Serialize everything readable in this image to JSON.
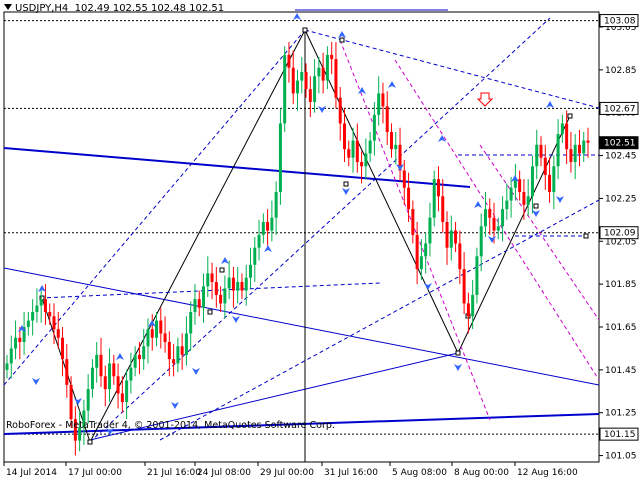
{
  "header": {
    "symbol": "USDJPY,H4",
    "ohlc": "102.49 102.55 102.48 102.51"
  },
  "footer": {
    "copyright": "RoboForex - MetaTrader 4, © 2001-2014, MetaQuotes Software Corp."
  },
  "colors": {
    "bull": "#00b050",
    "bear": "#ff0000",
    "trendline": "#0000cc",
    "fork": "#cc00cc",
    "current_price_bg": "#000000"
  },
  "chart_data": {
    "type": "candlestick",
    "title": "",
    "ylim": [
      101.02,
      103.12
    ],
    "x_tick_labels": [
      "14 Jul 2014",
      "17 Jul 00:00",
      "21 Jul 16:00",
      "24 Jul 08:00",
      "29 Jul 00:00",
      "31 Jul 16:00",
      "5 Aug 08:00",
      "8 Aug 00:00",
      "12 Aug 16:00"
    ],
    "y_tick_labels": [
      "103.05",
      "102.85",
      "102.65",
      "102.45",
      "102.25",
      "102.05",
      "101.85",
      "101.65",
      "101.45",
      "101.25",
      "101.05"
    ],
    "y_tick_values": [
      103.05,
      102.85,
      102.65,
      102.45,
      102.25,
      102.05,
      101.85,
      101.65,
      101.45,
      101.25,
      101.05
    ],
    "price_labels": [
      {
        "text": "103.08",
        "value": 103.08,
        "style": "normal"
      },
      {
        "text": "102.67",
        "value": 102.67,
        "style": "normal"
      },
      {
        "text": "102.51",
        "value": 102.51,
        "style": "current"
      },
      {
        "text": "102.09",
        "value": 102.09,
        "style": "normal"
      },
      {
        "text": "101.15",
        "value": 101.15,
        "style": "normal"
      }
    ],
    "dotted_levels": [
      103.08,
      102.67,
      102.09,
      101.15
    ],
    "close_series": [
      101.48,
      101.55,
      101.6,
      101.58,
      101.65,
      101.68,
      101.72,
      101.75,
      101.78,
      101.72,
      101.7,
      101.64,
      101.6,
      101.5,
      101.38,
      101.22,
      101.12,
      101.18,
      101.26,
      101.36,
      101.46,
      101.52,
      101.42,
      101.36,
      101.48,
      101.42,
      101.34,
      101.3,
      101.4,
      101.46,
      101.52,
      101.5,
      101.56,
      101.64,
      101.6,
      101.68,
      101.62,
      101.58,
      101.5,
      101.48,
      101.56,
      101.52,
      101.62,
      101.72,
      101.78,
      101.74,
      101.84,
      101.9,
      101.86,
      101.8,
      101.76,
      101.83,
      101.88,
      101.82,
      101.86,
      101.82,
      101.88,
      101.94,
      102.02,
      102.08,
      102.14,
      102.1,
      102.16,
      102.28,
      102.6,
      102.92,
      102.86,
      102.74,
      102.8,
      102.84,
      102.76,
      102.7,
      102.82,
      102.86,
      102.8,
      102.92,
      102.9,
      102.72,
      102.6,
      102.48,
      102.44,
      102.52,
      102.42,
      102.4,
      102.46,
      102.52,
      102.64,
      102.74,
      102.68,
      102.56,
      102.48,
      102.5,
      102.38,
      102.3,
      102.2,
      102.08,
      101.92,
      101.98,
      102.04,
      102.16,
      102.34,
      102.26,
      102.14,
      102.02,
      102.1,
      102.04,
      101.92,
      101.76,
      101.7,
      101.8,
      101.98,
      102.12,
      102.2,
      102.16,
      102.1,
      102.12,
      102.2,
      102.24,
      102.3,
      102.34,
      102.28,
      102.22,
      102.26,
      102.4,
      102.5,
      102.44,
      102.36,
      102.28,
      102.4,
      102.55,
      102.6,
      102.48,
      102.42,
      102.5,
      102.46,
      102.52,
      102.51
    ]
  }
}
